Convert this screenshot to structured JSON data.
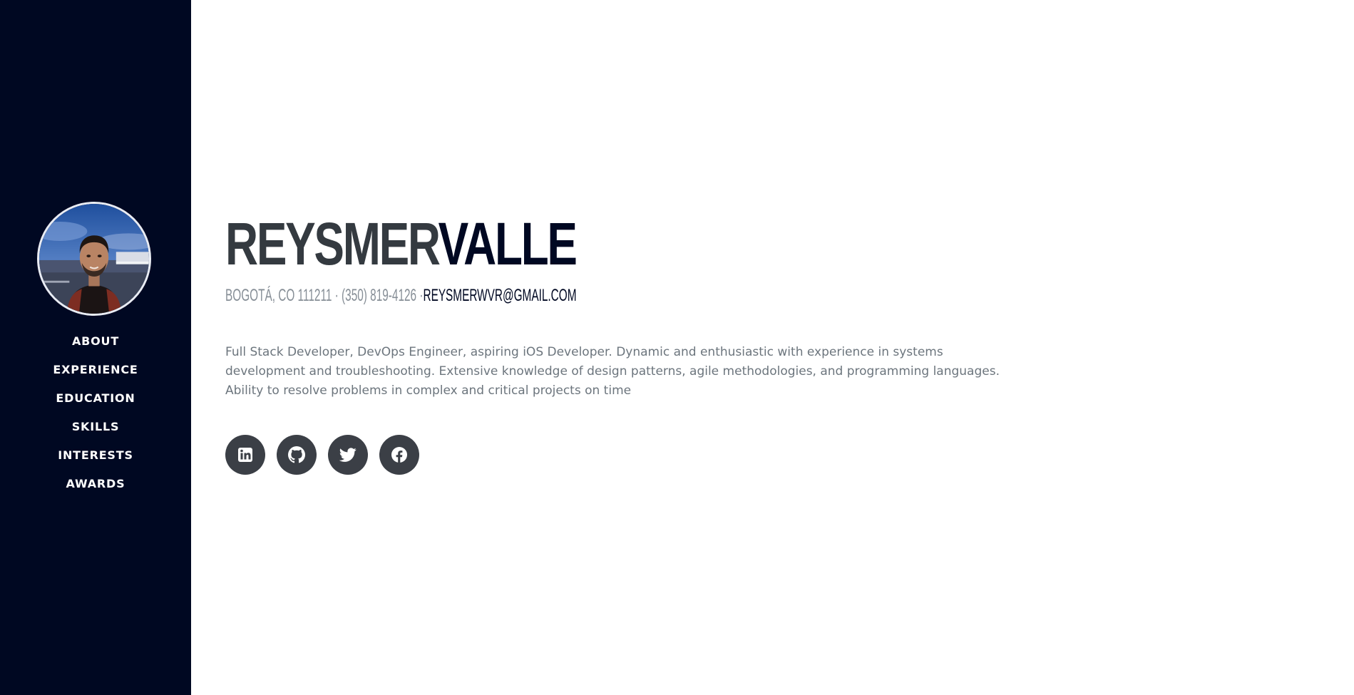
{
  "sidebar": {
    "background": "#000822",
    "avatar": {
      "alt": "profile photo"
    },
    "nav": [
      {
        "label": "ABOUT"
      },
      {
        "label": "EXPERIENCE"
      },
      {
        "label": "EDUCATION"
      },
      {
        "label": "SKILLS"
      },
      {
        "label": "INTERESTS"
      },
      {
        "label": "AWARDS"
      }
    ]
  },
  "profile": {
    "first_name": "REYSMER",
    "last_name": "VALLE",
    "location": "BOGOTÁ, CO 111211",
    "separator": " · ",
    "phone": "(350) 819-4126",
    "separator_2": " ·",
    "email": "REYSMERWVR@GMAIL.COM",
    "bio": "Full Stack Developer, DevOps Engineer, aspiring iOS Developer. Dynamic and enthusiastic with experience in systems development and troubleshooting. Extensive knowledge of design patterns, agile methodologies, and programming languages. Ability to resolve problems in complex and critical projects on time"
  },
  "social": [
    {
      "icon": "linkedin-icon"
    },
    {
      "icon": "github-icon"
    },
    {
      "icon": "twitter-icon"
    },
    {
      "icon": "facebook-icon"
    }
  ],
  "colors": {
    "accent": "#000822",
    "name_dark": "#343a40",
    "muted_text": "#868e96",
    "bio_text": "#6c757d",
    "social_button": "#3b3f46"
  }
}
